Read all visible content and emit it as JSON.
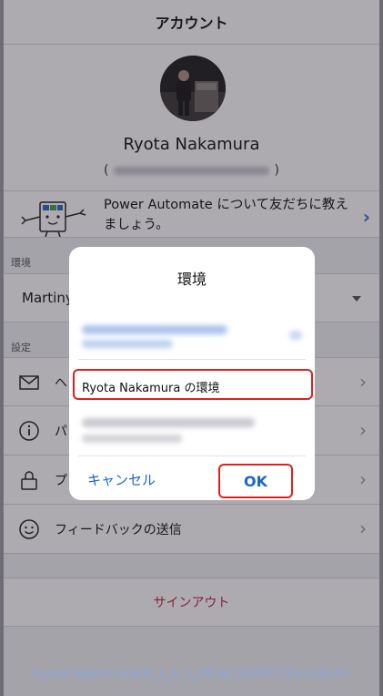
{
  "header": {
    "title": "アカウント"
  },
  "profile": {
    "name": "Ryota Nakamura",
    "email_open": "(",
    "email_close": ")"
  },
  "promo": {
    "text": "Power Automate について友だちに教えましょう。",
    "chevron": "›"
  },
  "environment": {
    "section_label": "環境",
    "value": "Martiny"
  },
  "settings": {
    "section_label": "設定",
    "rows": [
      {
        "label": "ヘ",
        "icon": "mail-icon"
      },
      {
        "label": "パ",
        "icon": "info-icon"
      },
      {
        "label": "プ",
        "icon": "lock-icon"
      },
      {
        "label": "フィードバックの送信",
        "icon": "smiley-icon"
      }
    ],
    "chevron": "›"
  },
  "signout": {
    "label": "サインアウト"
  },
  "dialog": {
    "title": "環境",
    "selected_option": "Ryota Nakamura の環境",
    "cancel_label": "キャンセル",
    "ok_label": "OK"
  },
  "watermark": {
    "text": "Ryota Nakamura(R_t_A_n_M) at 20200725124245"
  },
  "colors": {
    "accent": "#1a66cc",
    "danger": "#c0233d",
    "highlight": "#e02020"
  }
}
